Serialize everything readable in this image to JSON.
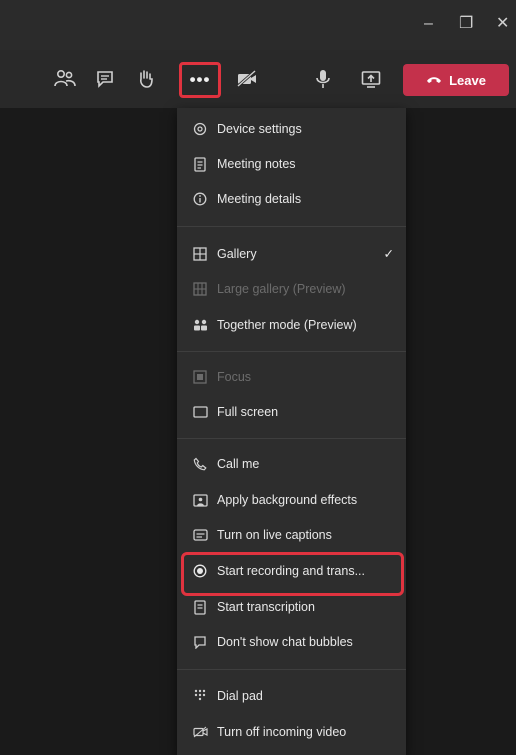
{
  "window": {
    "minimize_glyph": "–",
    "maximize_glyph": "❐",
    "close_glyph": "✕"
  },
  "toolbar": {
    "icons": [
      "people-icon",
      "chat-icon",
      "raise-hand-icon",
      "more-actions-icon",
      "camera-off-icon",
      "microphone-icon",
      "share-screen-icon"
    ],
    "more_glyph": "•••",
    "leave_label": "Leave",
    "accent": "#c4314b"
  },
  "menu": {
    "items": [
      {
        "label": "Device settings",
        "icon": "gear-icon"
      },
      {
        "label": "Meeting notes",
        "icon": "notes-icon"
      },
      {
        "label": "Meeting details",
        "icon": "info-icon"
      },
      {
        "label": "Gallery",
        "icon": "gallery-icon",
        "checked": true
      },
      {
        "label": "Large gallery (Preview)",
        "icon": "large-gallery-icon",
        "disabled": true
      },
      {
        "label": "Together mode (Preview)",
        "icon": "together-mode-icon"
      },
      {
        "label": "Focus",
        "icon": "focus-icon",
        "disabled": true
      },
      {
        "label": "Full screen",
        "icon": "full-screen-icon"
      },
      {
        "label": "Call me",
        "icon": "phone-icon"
      },
      {
        "label": "Apply background effects",
        "icon": "background-effects-icon"
      },
      {
        "label": "Turn on live captions",
        "icon": "captions-icon"
      },
      {
        "label": "Start recording and trans...",
        "icon": "record-icon"
      },
      {
        "label": "Start transcription",
        "icon": "transcription-icon"
      },
      {
        "label": "Don't show chat bubbles",
        "icon": "chat-bubble-icon"
      },
      {
        "label": "Dial pad",
        "icon": "dial-pad-icon"
      },
      {
        "label": "Turn off incoming video",
        "icon": "incoming-video-off-icon"
      }
    ],
    "check_glyph": "✓",
    "highlight_color": "#e0333f"
  }
}
